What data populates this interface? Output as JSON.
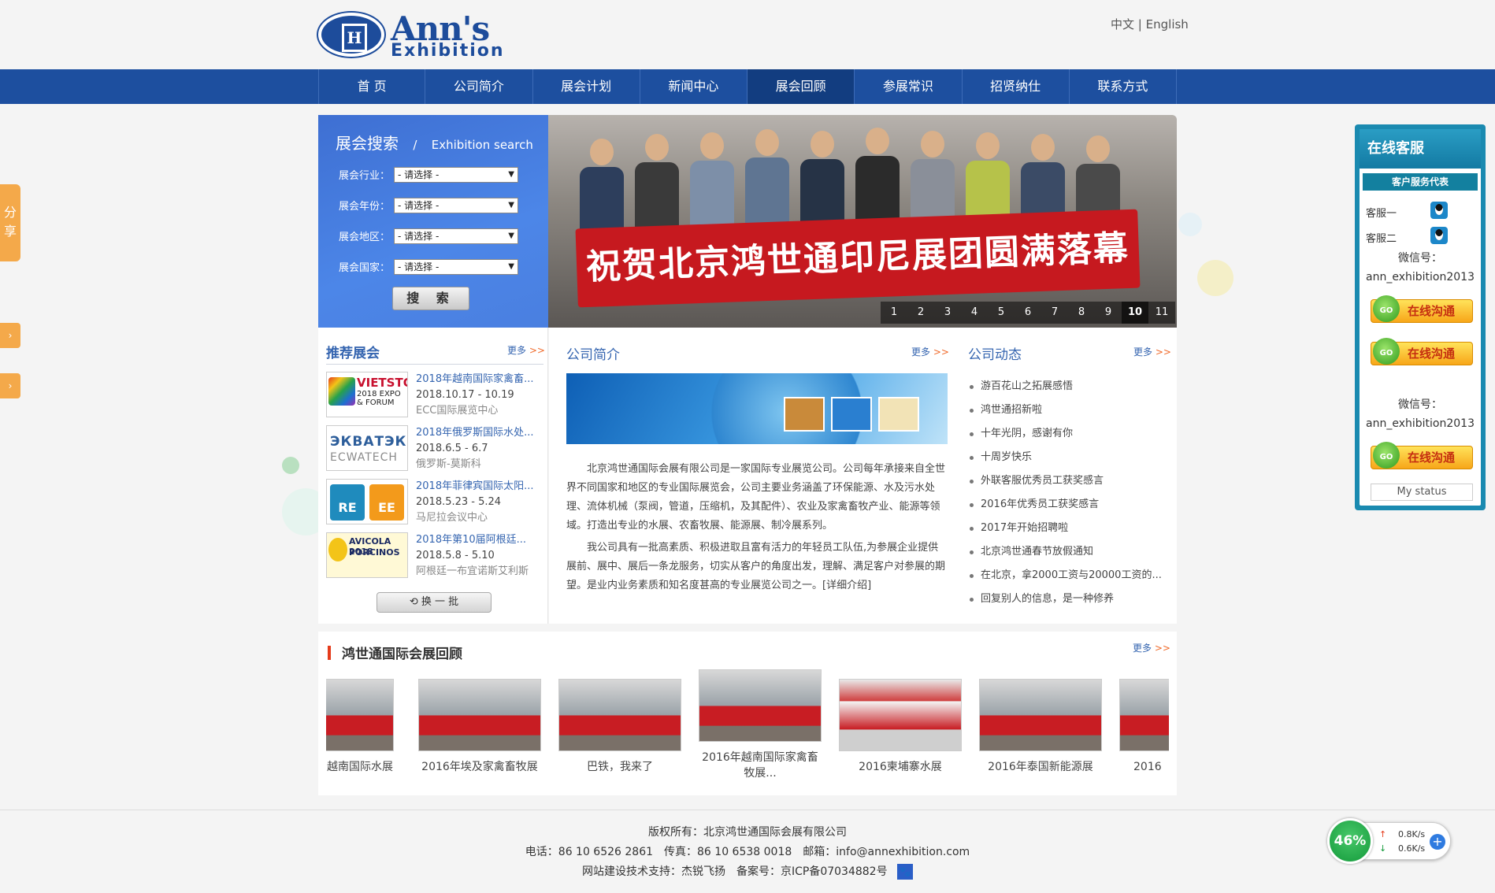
{
  "header": {
    "logo_text1": "Ann's",
    "logo_text2": "Exhibition",
    "lang_cn": "中文",
    "lang_sep": "|",
    "lang_en": "English"
  },
  "nav": [
    "首 页",
    "公司简介",
    "展会计划",
    "新闻中心",
    "展会回顾",
    "参展常识",
    "招贤纳仕",
    "联系方式"
  ],
  "search": {
    "title": "展会搜索",
    "title_sep": "/",
    "title_en": "Exhibition search",
    "fields": [
      {
        "label": "展会行业：",
        "value": "- 请选择 -"
      },
      {
        "label": "展会年份：",
        "value": "- 请选择 -"
      },
      {
        "label": "展会地区：",
        "value": "- 请选择 -"
      },
      {
        "label": "展会国家：",
        "value": "- 请选择 -"
      }
    ],
    "button": "搜 索"
  },
  "banner": {
    "flag_text": "祝贺北京鸿世通印尼展团圆满落幕",
    "pages": [
      "1",
      "2",
      "3",
      "4",
      "5",
      "6",
      "7",
      "8",
      "9",
      "10",
      "11"
    ],
    "active_page": "10"
  },
  "recommend": {
    "title": "推荐展会",
    "more": "更多",
    "more_arrow": ">>",
    "items": [
      {
        "logo": "VIETSTOCK 2018 EXPO & FORUM",
        "title": "2018年越南国际家禽畜...",
        "date": "2018.10.17 - 10.19",
        "place": "ECC国际展览中心"
      },
      {
        "logo": "ЭКВАТЭК ECWATECH",
        "title": "2018年俄罗斯国际水处...",
        "date": "2018.6.5 - 6.7",
        "place": "俄罗斯-莫斯科"
      },
      {
        "logo": "RE EE PHILIPPINES",
        "title": "2018年菲律宾国际太阳...",
        "date": "2018.5.23 - 5.24",
        "place": "马尼拉会议中心"
      },
      {
        "logo": "AVICOLA 2018 PORCINOS",
        "title": "2018年第10届阿根廷...",
        "date": "2018.5.8 - 5.10",
        "place": "阿根廷一布宜诺斯艾利斯"
      }
    ],
    "swap_button": "换 一 批"
  },
  "about": {
    "title": "公司简介",
    "more": "更多",
    "more_arrow": ">>",
    "paragraph1": "北京鸿世通国际会展有限公司是一家国际专业展览公司。公司每年承接来自全世界不同国家和地区的专业国际展览会，公司主要业务涵盖了环保能源、水及污水处理、流体机械（泵阀，管道，压缩机，及其配件）、农业及家禽畜牧产业、能源等领域。打造出专业的水展、农畜牧展、能源展、制冷展系列。",
    "paragraph2": "我公司具有一批高素质、积极进取且富有活力的年轻员工队伍,为参展企业提供展前、展中、展后一条龙服务，切实从客户的角度出发，理解、满足客户对参展的期望。是业内业务素质和知名度甚高的专业展览公司之一。[详细介绍]"
  },
  "news": {
    "title": "公司动态",
    "more": "更多",
    "more_arrow": ">>",
    "items": [
      "游百花山之拓展感悟",
      "鸿世通招新啦",
      "十年光阴，感谢有你",
      "十周岁快乐",
      "外联客服优秀员工获奖感言",
      "2016年优秀员工获奖感言",
      "2017年开始招聘啦",
      "北京鸿世通春节放假通知",
      "在北京，拿2000工资与20000工资的...",
      "回复别人的信息，是一种修养"
    ]
  },
  "review": {
    "title": "鸿世通国际会展回顾",
    "more": "更多",
    "more_arrow": ">>",
    "items": [
      "越南国际水展",
      "2016年埃及家禽畜牧展",
      "巴铁，我来了",
      "2016年越南国际家禽畜牧展...",
      "2016柬埔寨水展",
      "2016年泰国新能源展",
      "2016"
    ],
    "photo_banners": [
      "越南国际展团圆满落幕",
      "北京鸿世通埃及展团圆满落幕",
      "祝贺北京鸿世通巴基斯坦展团圆满落幕",
      "祝贺北京鸿世通越南展团圆满落幕",
      "CAMBUILD'16",
      "祝贺北京鸿世通泰国展团圆满落幕",
      "祝贺北京鸿世通"
    ]
  },
  "footer": {
    "copyright": "版权所有：北京鸿世通国际会展有限公司",
    "contact": "电话：86 10 6526 2861　传真：86 10 6538 0018　邮箱：info@annexhibition.com",
    "support": "网站建设技术支持：杰锐飞扬　备案号：京ICP备07034882号"
  },
  "service": {
    "title": "在线客服",
    "subtitle": "客户服务代表",
    "agents": [
      "客服一",
      "客服二"
    ],
    "wechat_label": "微信号：",
    "wechat_id": "ann_exhibition2013",
    "chat_button": "在线沟通",
    "go": "GO",
    "status": "My status"
  },
  "share": {
    "label": "分享",
    "tab2": "›",
    "tab3": "›"
  },
  "speed": {
    "percent": "46%",
    "up": "0.8K/s",
    "down": "0.6K/s",
    "up_arrow": "↑",
    "down_arrow": "↓",
    "plus": "+"
  },
  "colors": {
    "nav": "#1d4f9f",
    "nav_active": "#123d80",
    "link": "#3565b0",
    "more_arrow": "#f06a2b",
    "service": "#1a8ab0",
    "accent": "#e53b1b"
  }
}
